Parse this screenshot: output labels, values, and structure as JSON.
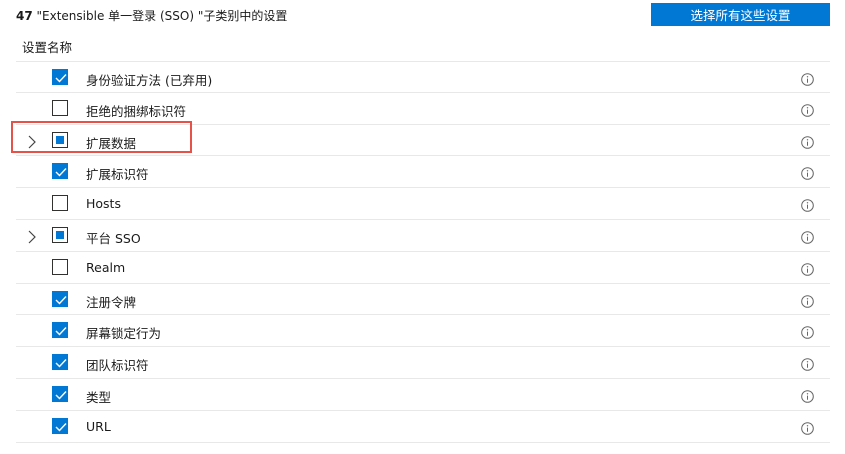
{
  "header": {
    "count": "47",
    "title_rest": " \"Extensible 单一登录 (SSO) \"子类别中的设置",
    "select_all_label": "选择所有这些设置"
  },
  "column_header": "设置名称",
  "rows": [
    {
      "label": "身份验证方法 (已弃用)",
      "state": "checked",
      "expandable": false
    },
    {
      "label": "拒绝的捆绑标识符",
      "state": "unchecked",
      "expandable": false
    },
    {
      "label": "扩展数据",
      "state": "partial",
      "expandable": true
    },
    {
      "label": "扩展标识符",
      "state": "checked",
      "expandable": false
    },
    {
      "label": "Hosts",
      "state": "unchecked",
      "expandable": false
    },
    {
      "label": "平台 SSO",
      "state": "partial",
      "expandable": true
    },
    {
      "label": "Realm",
      "state": "unchecked",
      "expandable": false
    },
    {
      "label": "注册令牌",
      "state": "checked",
      "expandable": false
    },
    {
      "label": "屏幕锁定行为",
      "state": "checked",
      "expandable": false
    },
    {
      "label": "团队标识符",
      "state": "checked",
      "expandable": false
    },
    {
      "label": "类型",
      "state": "checked",
      "expandable": false
    },
    {
      "label": "URL",
      "state": "checked",
      "expandable": false
    }
  ],
  "colors": {
    "accent": "#0078d4",
    "highlight": "#e5524a"
  },
  "icons": {
    "chevron": "chevron-right-icon",
    "info": "info-icon",
    "check": "checkmark-icon"
  }
}
